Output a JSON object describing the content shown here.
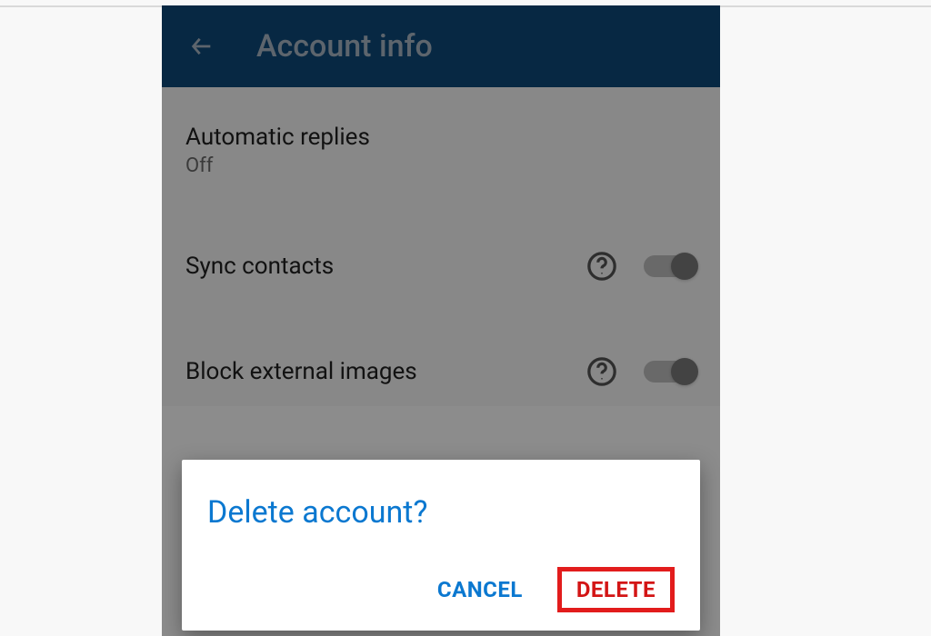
{
  "appbar": {
    "title": "Account info"
  },
  "rows": {
    "auto_replies": {
      "title": "Automatic replies",
      "value": "Off"
    },
    "sync_contacts": {
      "title": "Sync contacts"
    },
    "block_images": {
      "title": "Block external images"
    }
  },
  "dialog": {
    "title": "Delete account?",
    "cancel": "CANCEL",
    "delete": "DELETE"
  }
}
